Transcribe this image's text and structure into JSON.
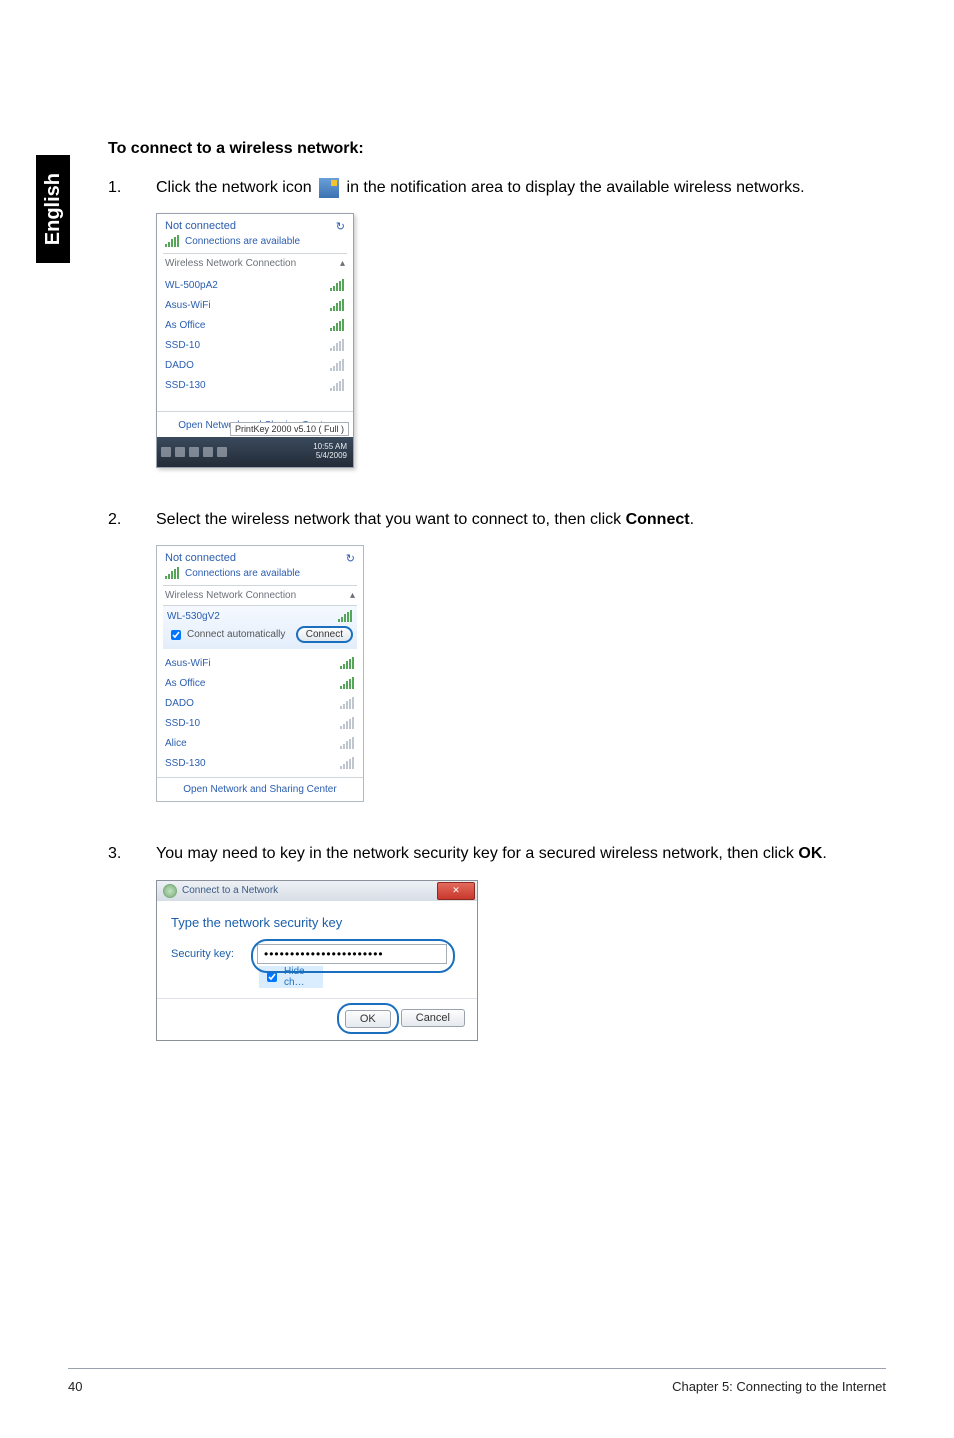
{
  "sidebar": {
    "language": "English"
  },
  "heading": "To connect to a wireless network:",
  "step1": {
    "num": "1.",
    "pre": "Click the network icon",
    "post": "in the notification area to display the available wireless networks."
  },
  "popup1": {
    "not_connected": "Not connected",
    "connections_available": "Connections are available",
    "section_label": "Wireless Network Connection",
    "items": [
      {
        "name": "WL-500pA2"
      },
      {
        "name": "Asus-WiFi"
      },
      {
        "name": "As Office"
      },
      {
        "name": "SSD-10"
      },
      {
        "name": "DADO"
      },
      {
        "name": "SSD-130"
      }
    ],
    "footer": "Open Network and Sharing Center",
    "tooltip": "PrintKey 2000 v5.10 ( Full )",
    "clock_time": "10:55 AM",
    "clock_date": "5/4/2009"
  },
  "step2": {
    "num": "2.",
    "text_pre": "Select the wireless network that you want to connect to, then click ",
    "bold": "Connect",
    "text_post": "."
  },
  "popup2": {
    "not_connected": "Not connected",
    "connections_available": "Connections are available",
    "section_label": "Wireless Network Connection",
    "selected_name": "WL-530gV2",
    "connect_auto": "Connect automatically",
    "connect_btn": "Connect",
    "items": [
      {
        "name": "Asus-WiFi"
      },
      {
        "name": "As Office"
      },
      {
        "name": "DADO"
      },
      {
        "name": "SSD-10"
      },
      {
        "name": "Alice"
      },
      {
        "name": "SSD-130"
      }
    ],
    "footer": "Open Network and Sharing Center"
  },
  "step3": {
    "num": "3.",
    "text_pre": "You may need to key in the network security key for a secured wireless network, then click ",
    "bold": "OK",
    "text_post": "."
  },
  "dialog3": {
    "title": "Connect to a Network",
    "heading": "Type the network security key",
    "label": "Security key:",
    "value": "•••••••••••••••••••••••",
    "hide": "Hide ch…",
    "ok": "OK",
    "cancel": "Cancel"
  },
  "footer": {
    "page": "40",
    "chapter": "Chapter 5: Connecting to the Internet"
  }
}
